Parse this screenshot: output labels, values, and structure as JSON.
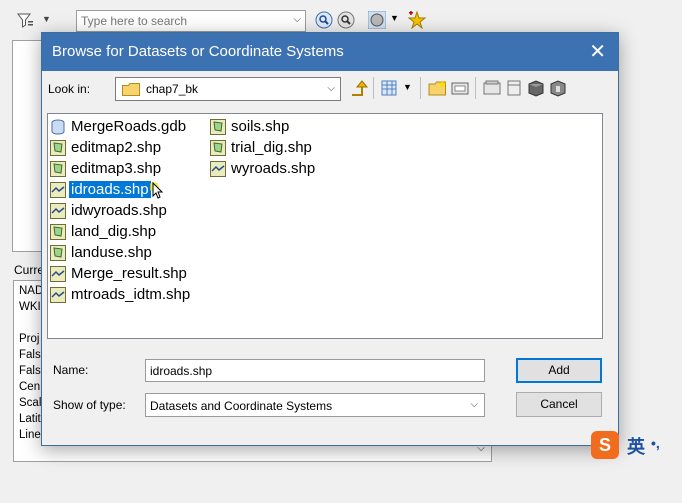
{
  "background": {
    "search_placeholder": "Type here to search",
    "current_label": "Curre",
    "current_lines": [
      "NAD",
      "WKI",
      "",
      "Proj",
      "Fals",
      "Fals",
      "Cen",
      "Scal",
      "Latit",
      "Line"
    ]
  },
  "dialog": {
    "title": "Browse for Datasets or Coordinate Systems",
    "look_in_label": "Look in:",
    "look_in_value": "chap7_bk",
    "files_col1": [
      {
        "name": "MergeRoads.gdb",
        "icon": "geodatabase-icon"
      },
      {
        "name": "editmap2.shp",
        "icon": "polygon-shapefile-icon"
      },
      {
        "name": "editmap3.shp",
        "icon": "polygon-shapefile-icon"
      },
      {
        "name": "idroads.shp",
        "icon": "line-shapefile-icon",
        "selected": true
      },
      {
        "name": "idwyroads.shp",
        "icon": "line-shapefile-icon"
      },
      {
        "name": "land_dig.shp",
        "icon": "polygon-shapefile-icon"
      },
      {
        "name": "landuse.shp",
        "icon": "polygon-shapefile-icon"
      },
      {
        "name": "Merge_result.shp",
        "icon": "line-shapefile-icon"
      },
      {
        "name": "mtroads_idtm.shp",
        "icon": "line-shapefile-icon"
      }
    ],
    "files_col2": [
      {
        "name": "soils.shp",
        "icon": "polygon-shapefile-icon"
      },
      {
        "name": "trial_dig.shp",
        "icon": "polygon-shapefile-icon"
      },
      {
        "name": "wyroads.shp",
        "icon": "line-shapefile-icon"
      }
    ],
    "name_label": "Name:",
    "name_value": "idroads.shp",
    "type_label": "Show of type:",
    "type_value": "Datasets and Coordinate Systems",
    "add_label": "Add",
    "cancel_label": "Cancel"
  },
  "ime": {
    "char": "英"
  }
}
